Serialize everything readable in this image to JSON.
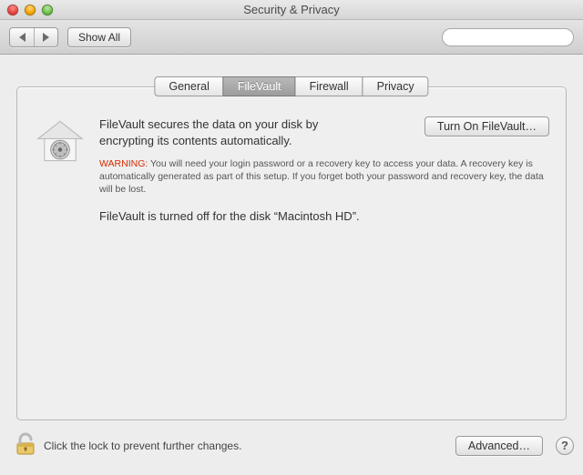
{
  "window": {
    "title": "Security & Privacy"
  },
  "toolbar": {
    "show_all_label": "Show All",
    "search_placeholder": ""
  },
  "tabs": {
    "general": "General",
    "filevault": "FileVault",
    "firewall": "Firewall",
    "privacy": "Privacy",
    "active": "filevault"
  },
  "filevault": {
    "description": "FileVault secures the data on your disk by encrypting its contents automatically.",
    "turn_on_label": "Turn On FileVault…",
    "warning_label": "WARNING:",
    "warning_text": "You will need your login password or a recovery key to access your data. A recovery key is automatically generated as part of this setup. If you forget both your password and recovery key, the data will be lost.",
    "status_text": "FileVault is turned off for the disk “Macintosh HD”."
  },
  "footer": {
    "lock_message": "Click the lock to prevent further changes.",
    "advanced_label": "Advanced…"
  }
}
